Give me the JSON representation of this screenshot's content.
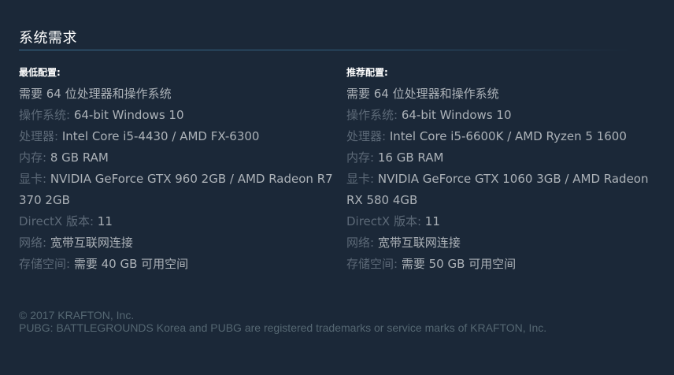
{
  "section_title": "系统需求",
  "minimum": {
    "title": "最低配置:",
    "requirement_note": "需要 64 位处理器和操作系统",
    "os": {
      "label": "操作系统:",
      "value": "64-bit Windows 10"
    },
    "processor": {
      "label": "处理器:",
      "value": "Intel Core i5-4430 / AMD FX-6300"
    },
    "memory": {
      "label": "内存:",
      "value": "8 GB RAM"
    },
    "graphics": {
      "label": "显卡:",
      "value": "NVIDIA GeForce GTX 960 2GB / AMD Radeon R7 370 2GB"
    },
    "directx": {
      "label": "DirectX 版本:",
      "value": "11"
    },
    "network": {
      "label": "网络:",
      "value": "宽带互联网连接"
    },
    "storage": {
      "label": "存储空间:",
      "value": "需要 40 GB 可用空间"
    }
  },
  "recommended": {
    "title": "推荐配置:",
    "requirement_note": "需要 64 位处理器和操作系统",
    "os": {
      "label": "操作系统:",
      "value": "64-bit Windows 10"
    },
    "processor": {
      "label": "处理器:",
      "value": "Intel Core i5-6600K / AMD Ryzen 5 1600"
    },
    "memory": {
      "label": "内存:",
      "value": "16 GB RAM"
    },
    "graphics": {
      "label": "显卡:",
      "value": "NVIDIA GeForce GTX 1060 3GB / AMD Radeon RX 580 4GB"
    },
    "directx": {
      "label": "DirectX 版本:",
      "value": "11"
    },
    "network": {
      "label": "网络:",
      "value": "宽带互联网连接"
    },
    "storage": {
      "label": "存储空间:",
      "value": "需要 50 GB 可用空间"
    }
  },
  "footer": {
    "copyright": "© 2017 KRAFTON, Inc.",
    "trademark": "PUBG: BATTLEGROUNDS Korea and PUBG are registered trademarks or service marks of KRAFTON, Inc."
  },
  "colors": {
    "background": "#1b2838",
    "heading": "#ffffff",
    "label": "#5c6977",
    "value": "#acb2b8",
    "rule": "#3b6e8f",
    "footer": "#556772"
  }
}
